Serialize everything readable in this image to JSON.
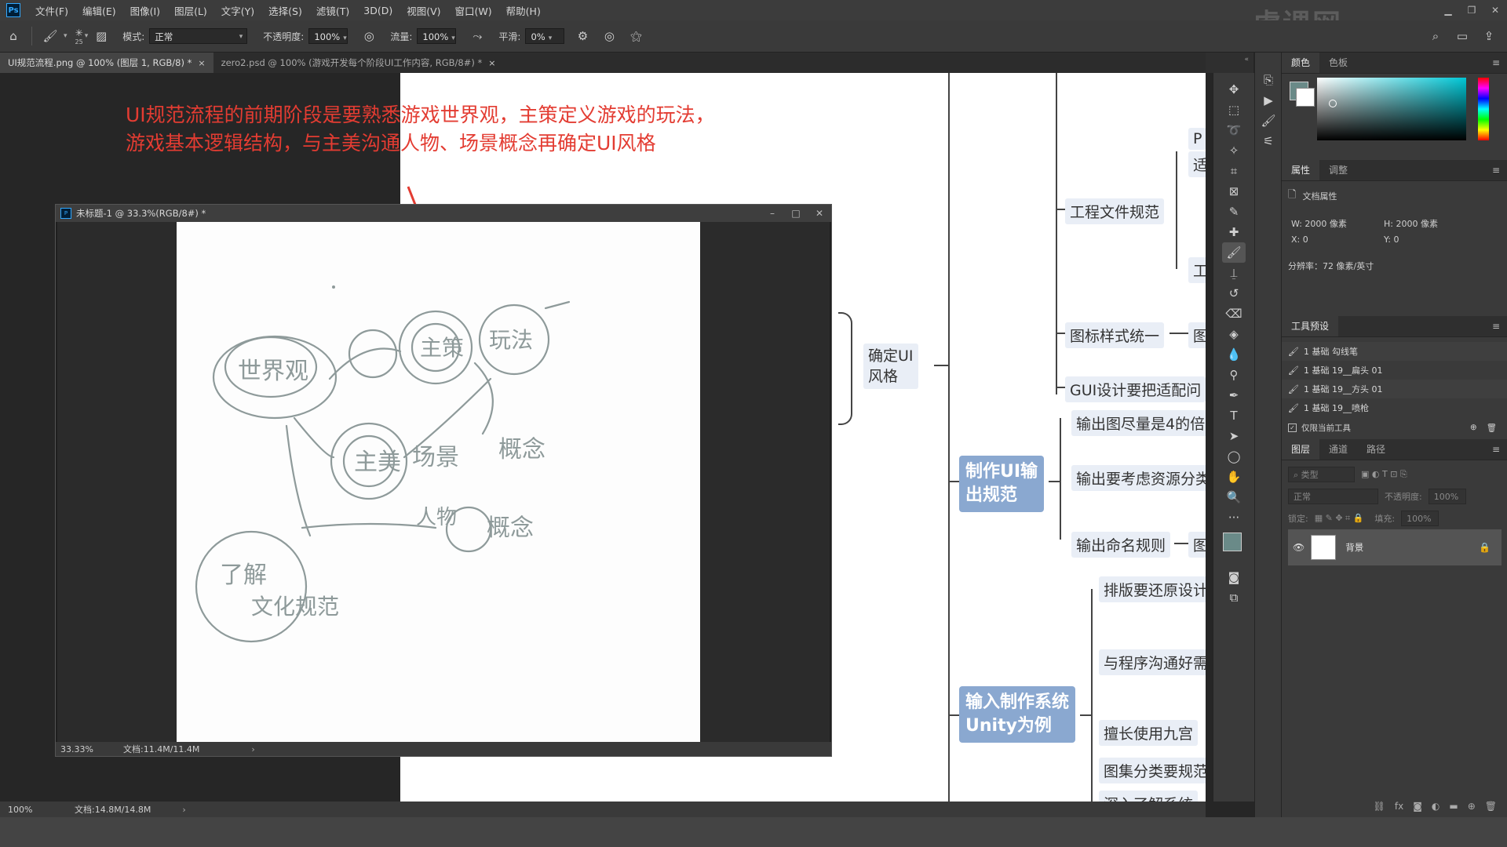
{
  "app": {
    "logo": "Ps",
    "watermark": "虎课网"
  },
  "menu": [
    "文件(F)",
    "编辑(E)",
    "图像(I)",
    "图层(L)",
    "文字(Y)",
    "选择(S)",
    "滤镜(T)",
    "3D(D)",
    "视图(V)",
    "窗口(W)",
    "帮助(H)"
  ],
  "options": {
    "brush_size": "25",
    "mode_label": "模式:",
    "mode_value": "正常",
    "opacity_label": "不透明度:",
    "opacity_value": "100%",
    "flow_label": "流量:",
    "flow_value": "100%",
    "smooth_label": "平滑:",
    "smooth_value": "0%"
  },
  "tabs": [
    {
      "label": "UI规范流程.png @ 100% (图层 1, RGB/8) *",
      "active": true
    },
    {
      "label": "zero2.psd @ 100% (游戏开发每个阶段UI工作内容, RGB/8#) *",
      "active": false
    }
  ],
  "annotation": {
    "line1": "UI规范流程的前期阶段是要熟悉游戏世界观，主策定义游戏的玩法，",
    "line2": "游戏基本逻辑结构，与主美沟通人物、场景概念再确定UI风格",
    "color": "#e33c32"
  },
  "mindmap": {
    "confirm_style": "确定UI\n风格",
    "main1": "制作UI输\n出规范",
    "main2": "输入制作系统\nUnity为例",
    "n_project": "工程文件规范",
    "n_icon_style": "图标样式统一",
    "n_gui": "GUI设计要把适配问",
    "n_out1": "输出图尽量是4的倍",
    "n_out2": "输出要考虑资源分类",
    "n_out3": "输出命名规则",
    "n_in1": "排版要还原设计",
    "n_in2": "与程序沟通好需",
    "n_in3": "擅长使用九宫",
    "n_in4": "图集分类要规范",
    "n_in5": "深入了解系统",
    "n_p": "P",
    "n_p2": "适",
    "n_icon_tail": "图",
    "n_out3_tail": "图",
    "n_small1": "工"
  },
  "float_window": {
    "title": "未标题-1 @ 33.3%(RGB/8#) *",
    "zoom": "33.33%",
    "doc_info": "文档:11.4M/11.4M",
    "sketch_labels": [
      "世界观",
      "主策",
      "玩法",
      "主美",
      "场景",
      "概念",
      "人物",
      "概念",
      "了解",
      "文化规范"
    ]
  },
  "status": {
    "zoom": "100%",
    "doc_info": "文档:14.8M/14.8M"
  },
  "panels": {
    "color_tabs": [
      "颜色",
      "色板"
    ],
    "props_tabs": [
      "属性",
      "调整"
    ],
    "doc_props": "文档属性",
    "w": "W:  2000 像素",
    "h": "H:  2000 像素",
    "x": "X:  0",
    "y": "Y:  0",
    "resolution": "分辨率：72 像素/英寸",
    "presets_title": "工具预设",
    "presets": [
      "1 基础    勾线笔",
      "1 基础    19__扁头  01",
      "1 基础    19__方头  01",
      "1 基础    19__喷枪"
    ],
    "current_tool_only": "仅限当前工具",
    "layers_tabs": [
      "图层",
      "通道",
      "路径"
    ],
    "layer_filter": "类型",
    "blend": "正常",
    "opacity_label": "不透明度:",
    "opacity_value": "100%",
    "lock_label": "锁定:",
    "fill_label": "填充:",
    "fill_value": "100%",
    "layer_name": "背景"
  }
}
